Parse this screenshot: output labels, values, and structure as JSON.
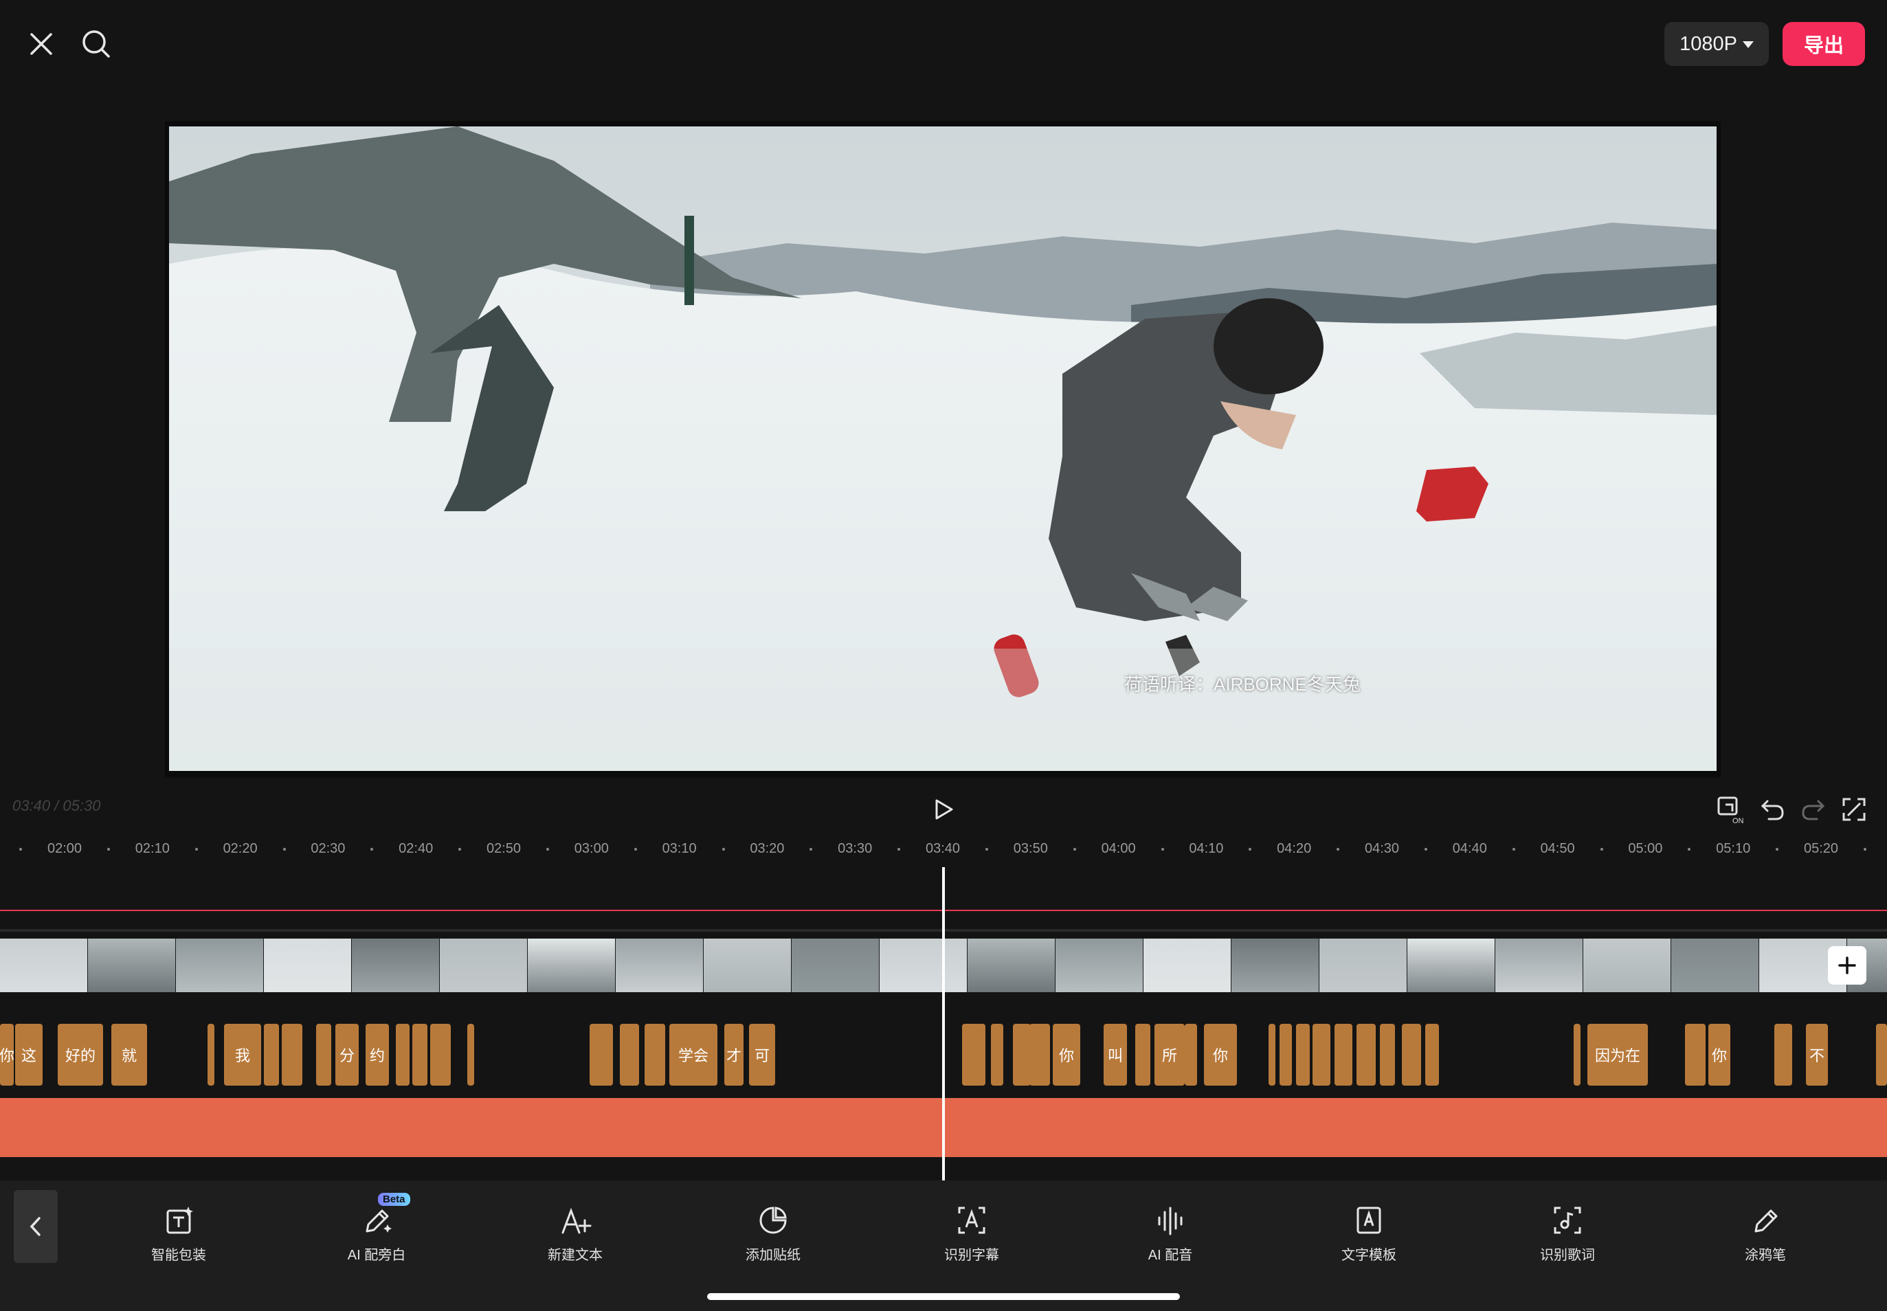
{
  "header": {
    "resolution": "1080P",
    "export_label": "导出"
  },
  "preview": {
    "watermark": "荷语听译：AIRBORNE冬天兔"
  },
  "player": {
    "timecode": "03:40 / 05:30"
  },
  "timeline": {
    "ruler_labels": [
      "02:00",
      "02:10",
      "02:20",
      "02:30",
      "02:40",
      "02:50",
      "03:00",
      "03:10",
      "03:20",
      "03:30",
      "03:40",
      "03:50",
      "04:00",
      "04:10",
      "04:20",
      "04:30",
      "04:40",
      "04:50",
      "05:00",
      "05:10",
      "05:20"
    ],
    "subtitle_texts": [
      "你",
      "这",
      "好的",
      "就",
      "我",
      "",
      "",
      "分",
      "约",
      "",
      "学会",
      "才",
      "可",
      "",
      "你",
      "叫",
      "所",
      "你",
      "",
      "",
      "因为在",
      "",
      "你",
      "不"
    ]
  },
  "toolbar": {
    "tools": [
      {
        "label": "智能包装",
        "icon": "smart-package-icon"
      },
      {
        "label": "AI 配旁白",
        "icon": "ai-narration-icon",
        "badge": "Beta"
      },
      {
        "label": "新建文本",
        "icon": "new-text-icon"
      },
      {
        "label": "添加贴纸",
        "icon": "sticker-icon"
      },
      {
        "label": "识别字幕",
        "icon": "recognize-subtitle-icon"
      },
      {
        "label": "AI 配音",
        "icon": "ai-dubbing-icon"
      },
      {
        "label": "文字模板",
        "icon": "text-template-icon"
      },
      {
        "label": "识别歌词",
        "icon": "recognize-lyrics-icon"
      },
      {
        "label": "涂鸦笔",
        "icon": "doodle-pen-icon"
      }
    ]
  },
  "colors": {
    "accent": "#f42c5a",
    "subtitle_clip": "#b87a3b",
    "audio_track": "#e4674c"
  }
}
